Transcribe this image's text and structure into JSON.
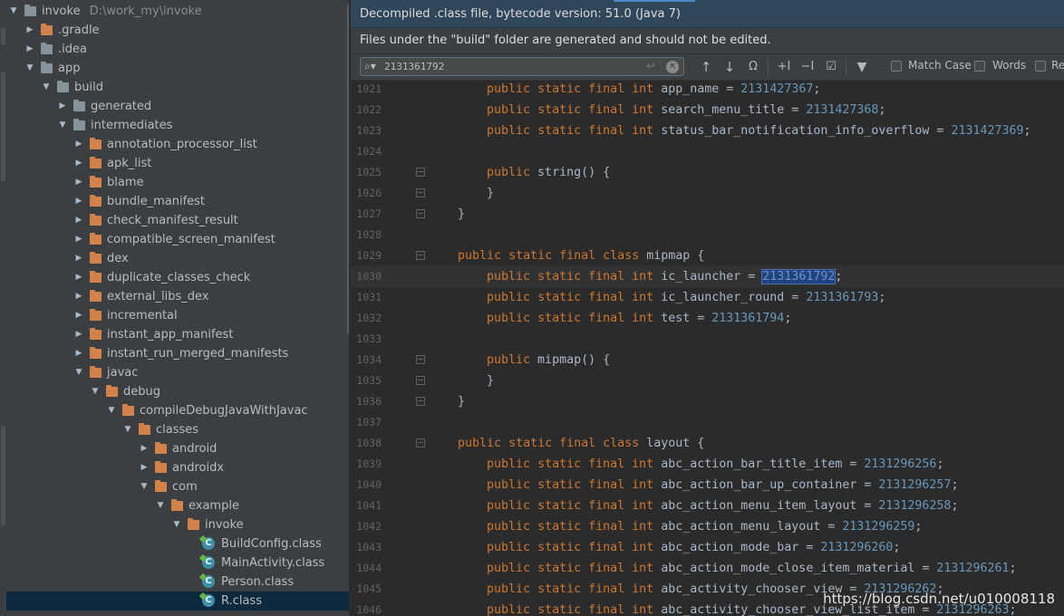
{
  "project": {
    "root": {
      "name": "invoke",
      "path": "D:\\work_my\\invoke"
    },
    "items": [
      {
        "label": ".gradle",
        "depth": 1,
        "arrow": "right",
        "icon": "orange"
      },
      {
        "label": ".idea",
        "depth": 1,
        "arrow": "right",
        "icon": "gray"
      },
      {
        "label": "app",
        "depth": 1,
        "arrow": "down",
        "icon": "gray"
      },
      {
        "label": "build",
        "depth": 2,
        "arrow": "down",
        "icon": "gray"
      },
      {
        "label": "generated",
        "depth": 3,
        "arrow": "right",
        "icon": "gray"
      },
      {
        "label": "intermediates",
        "depth": 3,
        "arrow": "down",
        "icon": "gray"
      },
      {
        "label": "annotation_processor_list",
        "depth": 4,
        "arrow": "right",
        "icon": "orange"
      },
      {
        "label": "apk_list",
        "depth": 4,
        "arrow": "right",
        "icon": "orange"
      },
      {
        "label": "blame",
        "depth": 4,
        "arrow": "right",
        "icon": "orange"
      },
      {
        "label": "bundle_manifest",
        "depth": 4,
        "arrow": "right",
        "icon": "orange"
      },
      {
        "label": "check_manifest_result",
        "depth": 4,
        "arrow": "right",
        "icon": "orange"
      },
      {
        "label": "compatible_screen_manifest",
        "depth": 4,
        "arrow": "right",
        "icon": "orange"
      },
      {
        "label": "dex",
        "depth": 4,
        "arrow": "right",
        "icon": "orange"
      },
      {
        "label": "duplicate_classes_check",
        "depth": 4,
        "arrow": "right",
        "icon": "orange"
      },
      {
        "label": "external_libs_dex",
        "depth": 4,
        "arrow": "right",
        "icon": "orange"
      },
      {
        "label": "incremental",
        "depth": 4,
        "arrow": "right",
        "icon": "orange"
      },
      {
        "label": "instant_app_manifest",
        "depth": 4,
        "arrow": "right",
        "icon": "orange"
      },
      {
        "label": "instant_run_merged_manifests",
        "depth": 4,
        "arrow": "right",
        "icon": "orange"
      },
      {
        "label": "javac",
        "depth": 4,
        "arrow": "down",
        "icon": "orange"
      },
      {
        "label": "debug",
        "depth": 5,
        "arrow": "down",
        "icon": "orange"
      },
      {
        "label": "compileDebugJavaWithJavac",
        "depth": 6,
        "arrow": "down",
        "icon": "orange"
      },
      {
        "label": "classes",
        "depth": 7,
        "arrow": "down",
        "icon": "orange"
      },
      {
        "label": "android",
        "depth": 8,
        "arrow": "right",
        "icon": "orange"
      },
      {
        "label": "androidx",
        "depth": 8,
        "arrow": "right",
        "icon": "orange"
      },
      {
        "label": "com",
        "depth": 8,
        "arrow": "down",
        "icon": "orange"
      },
      {
        "label": "example",
        "depth": 9,
        "arrow": "down",
        "icon": "orange"
      },
      {
        "label": "invoke",
        "depth": 10,
        "arrow": "down",
        "icon": "orange"
      },
      {
        "label": "BuildConfig.class",
        "depth": 11,
        "arrow": "none",
        "icon": "class"
      },
      {
        "label": "MainActivity.class",
        "depth": 11,
        "arrow": "none",
        "icon": "class"
      },
      {
        "label": "Person.class",
        "depth": 11,
        "arrow": "none",
        "icon": "class"
      },
      {
        "label": "R.class",
        "depth": 11,
        "arrow": "none",
        "icon": "class",
        "selected": true
      }
    ]
  },
  "editor": {
    "banner_decompiled": "Decompiled .class file, bytecode version: 51.0 (Java 7)",
    "banner_build": "Files under the \"build\" folder are generated and should not be edited.",
    "find": {
      "query": "2131361792",
      "match_case": "Match Case",
      "words": "Words",
      "regex": "Re"
    },
    "lines": [
      {
        "n": "1021",
        "indent": 2,
        "pre": "public static final int app_name = ",
        "num": "2131427367",
        "post": ";"
      },
      {
        "n": "1022",
        "indent": 2,
        "pre": "public static final int search_menu_title = ",
        "num": "2131427368",
        "post": ";"
      },
      {
        "n": "1023",
        "indent": 2,
        "pre": "public static final int status_bar_notification_info_overflow = ",
        "num": "2131427369",
        "post": ";"
      },
      {
        "n": "1024",
        "indent": 0,
        "pre": "",
        "num": "",
        "post": ""
      },
      {
        "n": "1025",
        "indent": 2,
        "pre": "public string() {",
        "num": "",
        "post": "",
        "fold": true
      },
      {
        "n": "1026",
        "indent": 2,
        "pre": "}",
        "num": "",
        "post": "",
        "fold": true
      },
      {
        "n": "1027",
        "indent": 1,
        "pre": "}",
        "num": "",
        "post": "",
        "fold": true
      },
      {
        "n": "1028",
        "indent": 0,
        "pre": "",
        "num": "",
        "post": ""
      },
      {
        "n": "1029",
        "indent": 1,
        "pre": "public static final class mipmap {",
        "num": "",
        "post": "",
        "fold": true
      },
      {
        "n": "1030",
        "indent": 2,
        "pre": "public static final int ic_launcher = ",
        "num": "2131361792",
        "post": ";",
        "current": true,
        "match": true
      },
      {
        "n": "1031",
        "indent": 2,
        "pre": "public static final int ic_launcher_round = ",
        "num": "2131361793",
        "post": ";"
      },
      {
        "n": "1032",
        "indent": 2,
        "pre": "public static final int test = ",
        "num": "2131361794",
        "post": ";"
      },
      {
        "n": "1033",
        "indent": 0,
        "pre": "",
        "num": "",
        "post": ""
      },
      {
        "n": "1034",
        "indent": 2,
        "pre": "public mipmap() {",
        "num": "",
        "post": "",
        "fold": true
      },
      {
        "n": "1035",
        "indent": 2,
        "pre": "}",
        "num": "",
        "post": "",
        "fold": true
      },
      {
        "n": "1036",
        "indent": 1,
        "pre": "}",
        "num": "",
        "post": "",
        "fold": true
      },
      {
        "n": "1037",
        "indent": 0,
        "pre": "",
        "num": "",
        "post": ""
      },
      {
        "n": "1038",
        "indent": 1,
        "pre": "public static final class layout {",
        "num": "",
        "post": "",
        "fold": true
      },
      {
        "n": "1039",
        "indent": 2,
        "pre": "public static final int abc_action_bar_title_item = ",
        "num": "2131296256",
        "post": ";"
      },
      {
        "n": "1040",
        "indent": 2,
        "pre": "public static final int abc_action_bar_up_container = ",
        "num": "2131296257",
        "post": ";"
      },
      {
        "n": "1041",
        "indent": 2,
        "pre": "public static final int abc_action_menu_item_layout = ",
        "num": "2131296258",
        "post": ";"
      },
      {
        "n": "1042",
        "indent": 2,
        "pre": "public static final int abc_action_menu_layout = ",
        "num": "2131296259",
        "post": ";"
      },
      {
        "n": "1043",
        "indent": 2,
        "pre": "public static final int abc_action_mode_bar = ",
        "num": "2131296260",
        "post": ";"
      },
      {
        "n": "1044",
        "indent": 2,
        "pre": "public static final int abc_action_mode_close_item_material = ",
        "num": "2131296261",
        "post": ";"
      },
      {
        "n": "1045",
        "indent": 2,
        "pre": "public static final int abc_activity_chooser_view = ",
        "num": "2131296262",
        "post": ";"
      },
      {
        "n": "1046",
        "indent": 2,
        "pre": "public static final int abc_activity_chooser_view_list_item = ",
        "num": "2131296263",
        "post": ";"
      }
    ]
  },
  "watermark": "https://blog.csdn.net/u010008118"
}
